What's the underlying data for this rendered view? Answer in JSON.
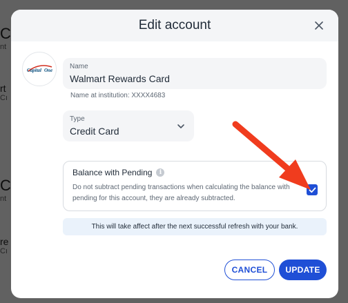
{
  "background": {
    "items": [
      {
        "big": "C",
        "small": "nt"
      },
      {
        "big": "rt",
        "small": "Cı"
      },
      {
        "big": "C",
        "small": "nt"
      },
      {
        "big": "re",
        "small": "Cı"
      }
    ]
  },
  "modal": {
    "title": "Edit account",
    "name_label": "Name",
    "name_value": "Walmart Rewards Card",
    "institution_text": "Name at institution: XXXX4683",
    "type_label": "Type",
    "type_value": "Credit Card",
    "pending_title": "Balance with Pending",
    "pending_desc": "Do not subtract pending transactions when calculating the balance with pending for this account, they are already subtracted.",
    "pending_checked": true,
    "notice": "This will take affect after the next successful refresh with your bank.",
    "cancel_label": "CANCEL",
    "update_label": "UPDATE",
    "logo_text": "Capital One"
  },
  "colors": {
    "accent": "#1f4fd6",
    "annotation_arrow": "#f03c1e",
    "logo_red": "#d22e1e",
    "logo_blue": "#004879"
  },
  "icons": {
    "close": "close-icon",
    "chevron": "chevron-down-icon",
    "info": "info-icon",
    "check": "check-icon"
  }
}
